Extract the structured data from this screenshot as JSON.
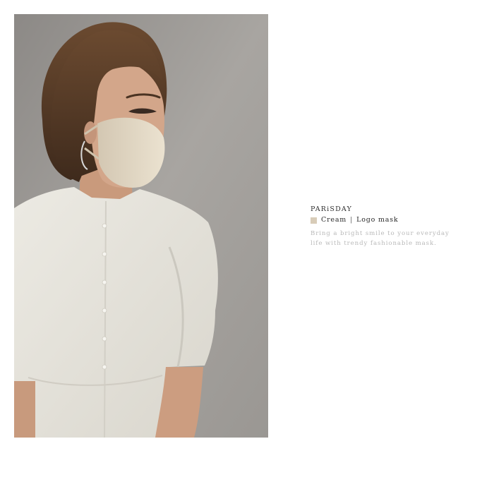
{
  "caption": {
    "brand": "PARiSDAY",
    "color_name": "Cream",
    "separator": "|",
    "product_name": "Logo mask",
    "swatch_color": "#d8ccb8",
    "description_line1": "Bring a bright smile to your everyday",
    "description_line2": "life with trendy fashionable mask."
  }
}
